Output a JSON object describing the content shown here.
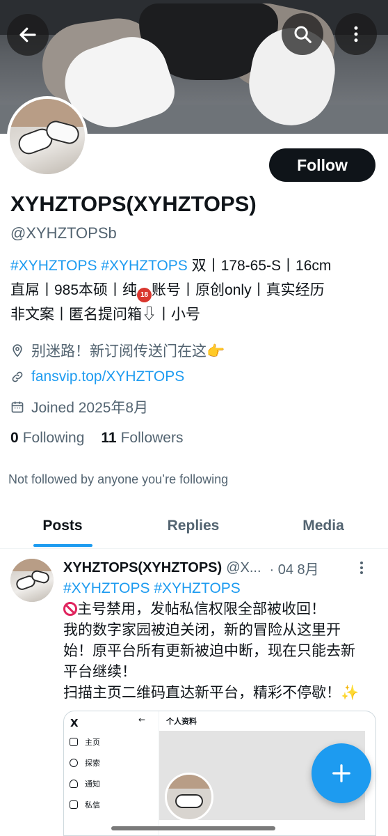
{
  "header": {
    "back_icon": "arrow-left-icon",
    "search_icon": "search-icon",
    "more_icon": "more-vertical-icon"
  },
  "profile": {
    "display_name": "XYHZTOPS(XYHZTOPS)",
    "handle": "@XYHZTOPSb",
    "follow_label": "Follow",
    "bio_line1_tags": "#XYHZTOPS #XYHZTOPS",
    "bio_line1_rest": " 双丨178-65-S丨16cm",
    "bio_line2_a": "直屌丨985本硕丨纯",
    "bio_line2_emoji": "18",
    "bio_line2_b": "账号丨原创only丨真实经历",
    "bio_line3": "非文案丨匿名提问箱⇩丨小号",
    "location": "别迷路！新订阅传送门在这👉",
    "link": "fansvip.top/XYHZTOPS",
    "joined": "Joined 2025年8月",
    "following_count": "0",
    "following_label": "Following",
    "followers_count": "11",
    "followers_label": "Followers",
    "not_followed_text": "Not followed by anyone you’re following"
  },
  "tabs": [
    {
      "label": "Posts",
      "active": true
    },
    {
      "label": "Replies",
      "active": false
    },
    {
      "label": "Media",
      "active": false
    }
  ],
  "post": {
    "name": "XYHZTOPS(XYHZTOPS)",
    "handle": "@X...",
    "date": "· 04 8月",
    "line1_tags": "#XYHZTOPS #XYHZTOPS",
    "line2": "主号禁用，发帖私信权限全部被收回！",
    "line3": "我的数字家园被迫关闭，新的冒险从这里开",
    "line4": "始！原平台所有更新被迫中断，现在只能去新",
    "line5": "平台继续！",
    "line6": "扫描主页二维码直达新平台，精彩不停歇！✨"
  },
  "embed": {
    "logo": "X",
    "side_items": [
      "主页",
      "探索",
      "通知",
      "私信"
    ],
    "title": "个人资料",
    "back": "←"
  },
  "colors": {
    "accent": "#1d9bf0",
    "text": "#0f1419",
    "secondary": "#536471"
  }
}
